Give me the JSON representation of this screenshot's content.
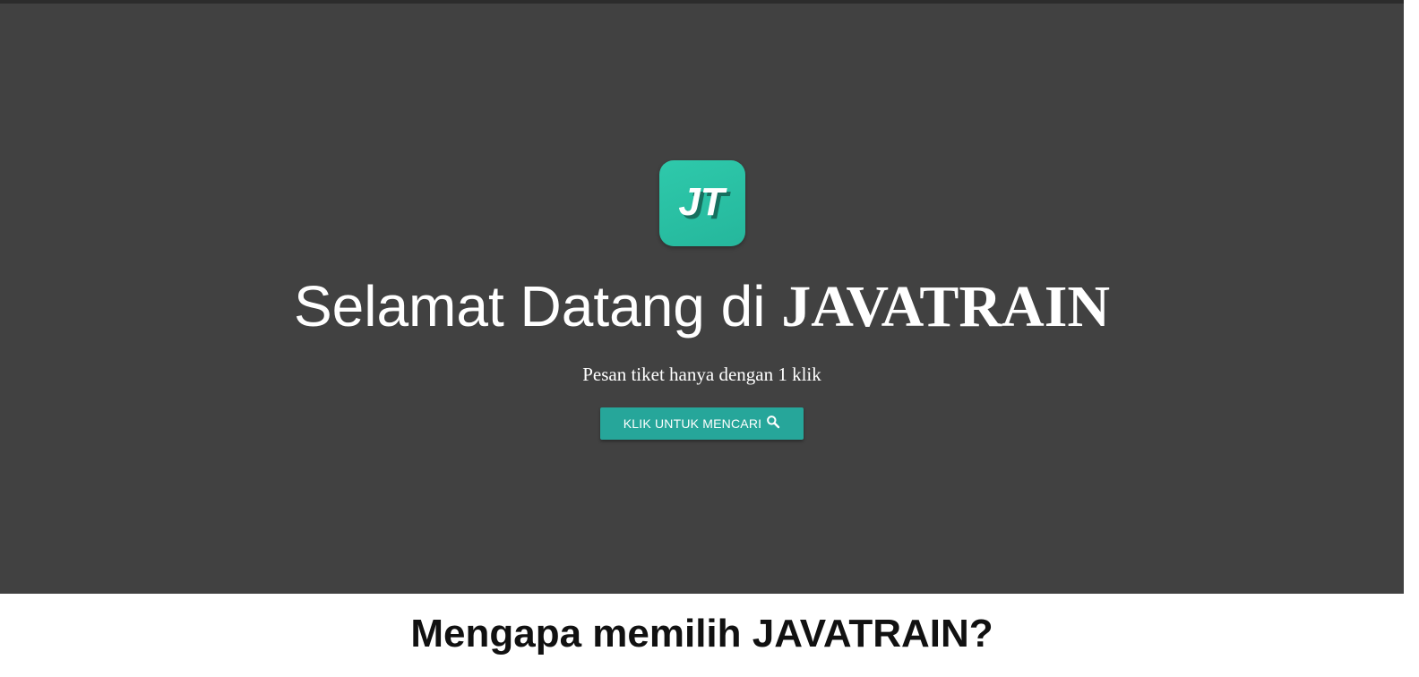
{
  "hero": {
    "logo_text": "JT",
    "title_prefix": "Selamat Datang di ",
    "title_brand": "JAVATRAIN",
    "subtitle": "Pesan tiket hanya dengan 1 klik",
    "search_button_label": "KLIK UNTUK MENCARI",
    "search_button_icon": "search-icon",
    "background_color": "#414141",
    "accent_color": "#26a69a"
  },
  "why_section": {
    "title_prefix": "Mengapa memilih ",
    "title_brand": "JAVATRAIN",
    "title_suffix": "?"
  }
}
